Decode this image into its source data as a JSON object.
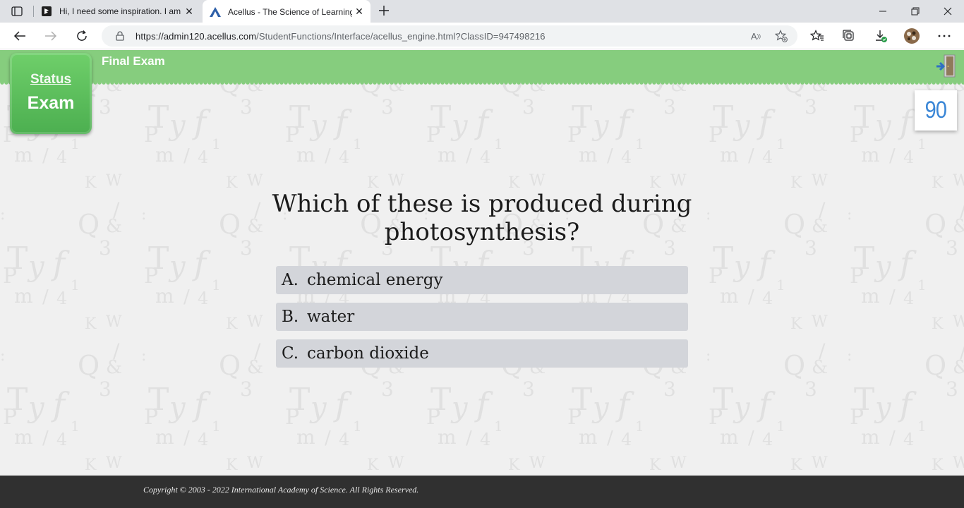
{
  "browser": {
    "tabs": [
      {
        "title": "Hi, I need some inspiration. I am",
        "icon": "bing-chat-icon",
        "active": false
      },
      {
        "title": "Acellus - The Science of Learning",
        "icon": "acellus-icon",
        "active": true
      }
    ],
    "url_host": "https://admin120.acellus.com",
    "url_path": "/StudentFunctions/Interface/acellus_engine.html?ClassID=947498216",
    "read_aloud_label": "A",
    "colors": {
      "tabbar": "#dfe1e5",
      "toolbar": "#ffffff",
      "address_bg": "#f1f3f4"
    }
  },
  "app": {
    "exam_title": "Final Exam",
    "status_link": "Status",
    "status_value": "Exam",
    "score": "90",
    "question": "Which of these is produced during photosynthesis?",
    "answers": [
      {
        "letter": "A.",
        "text": "chemical energy"
      },
      {
        "letter": "B.",
        "text": "water"
      },
      {
        "letter": "C.",
        "text": "carbon dioxide"
      }
    ],
    "copyright": "Copyright © 2003 - 2022 International Academy of Science.  All Rights Reserved.",
    "colors": {
      "header": "#86cd7e",
      "status_box": "#5cbf58",
      "answer_bg": "#d3d5da",
      "score": "#3a86d6",
      "footer": "#303030"
    }
  }
}
